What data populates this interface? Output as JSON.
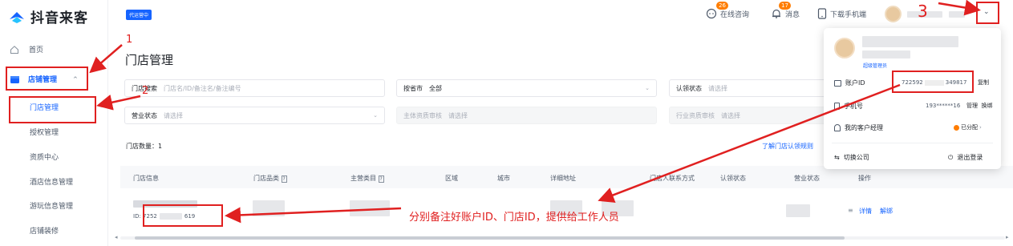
{
  "app": {
    "logo_text": "抖音来客"
  },
  "sidebar": {
    "home": "首页",
    "store_mgmt": "店铺管理",
    "items": [
      "门店管理",
      "授权管理",
      "资质中心",
      "酒店信息管理",
      "游玩信息管理",
      "店铺装修"
    ]
  },
  "topbar": {
    "tag": "代运营中",
    "consult": "在线咨询",
    "consult_badge": "26",
    "message": "消息",
    "message_badge": "17",
    "download": "下载手机端"
  },
  "page": {
    "title": "门店管理"
  },
  "filters": {
    "store_search_label": "门店搜索",
    "store_search_placeholder": "门店名/ID/备注名/备注编号",
    "province_label": "按省市",
    "province_value": "全部",
    "claim_label": "认领状态",
    "claim_placeholder": "请选择",
    "biz_label": "营业状态",
    "biz_placeholder": "请选择",
    "entity_label": "主体资质审核",
    "entity_placeholder": "请选择",
    "industry_label": "行业资质审核",
    "industry_placeholder": "请选择"
  },
  "count": {
    "label": "门店数量：",
    "value": "1",
    "link": "了解门店认领规则"
  },
  "table": {
    "headers": [
      "门店信息",
      "门店品类",
      "主营类目",
      "区域",
      "城市",
      "详细地址",
      "门店人联系方式",
      "认领状态",
      "营业状态",
      "操作"
    ],
    "row": {
      "id_prefix": "ID: 7252",
      "id_suffix": "619",
      "actions": [
        "详情",
        "解绑"
      ]
    }
  },
  "popup": {
    "role": "超级管理员",
    "account_label": "账户ID",
    "account_value": "722592",
    "account_suffix": "349817",
    "copy": "复制",
    "phone_label": "手机号",
    "phone_value": "193******16",
    "phone_actions": "管理  换绑",
    "manager_label": "我的客户经理",
    "manager_status": "已分配",
    "switch": "切换公司",
    "logout": "退出登录"
  },
  "annotations": {
    "n1": "1",
    "n2": "2",
    "n3": "3",
    "note": "分别备注好账户ID、门店ID，提供给工作人员"
  },
  "colors": {
    "brand": "#1664ff",
    "annotation": "#e02020",
    "badge": "#ff7d00"
  }
}
